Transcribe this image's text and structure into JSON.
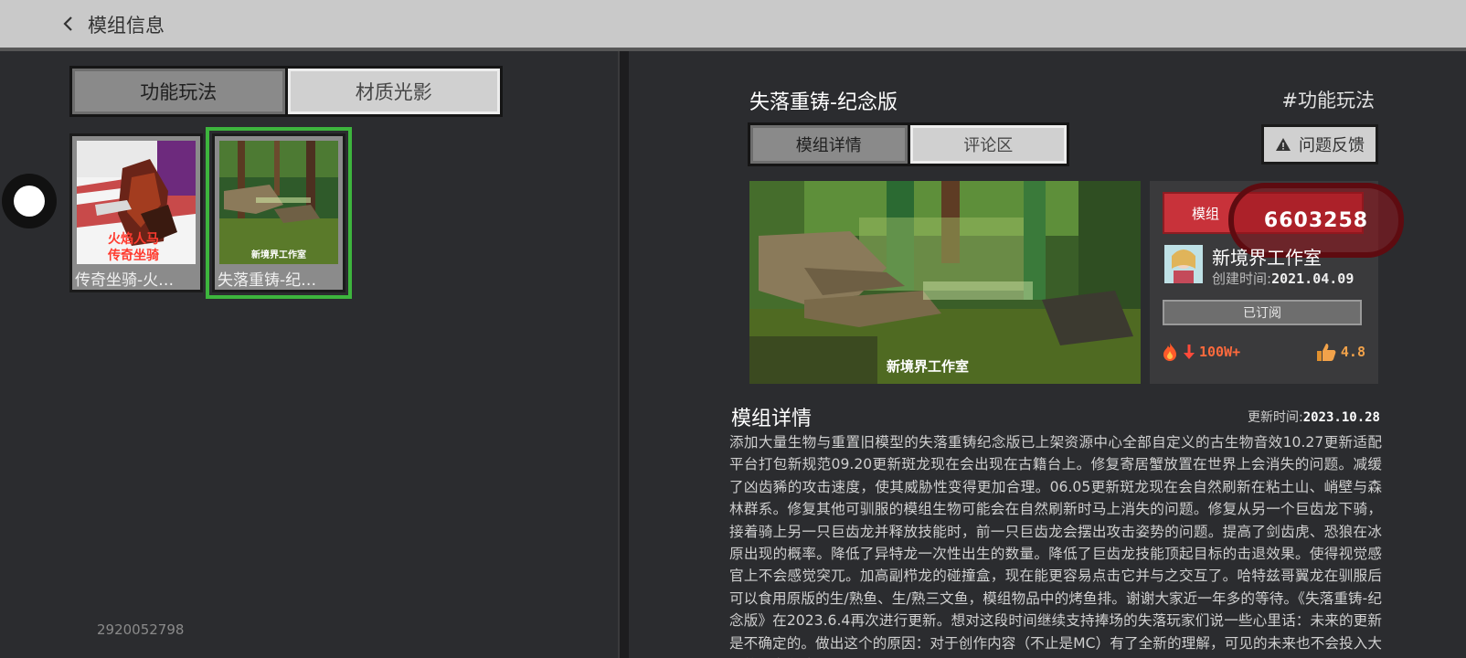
{
  "topbar": {
    "title": "模组信息"
  },
  "left": {
    "tabs": [
      {
        "label": "功能玩法",
        "active": true
      },
      {
        "label": "材质光影",
        "active": false
      }
    ],
    "cards": [
      {
        "name": "传奇坐骑-火…",
        "thumb_text": "火焰人马\n传奇坐骑",
        "selected": false
      },
      {
        "name": "失落重铸-纪…",
        "thumb_text": "新境界工作室",
        "selected": true
      }
    ],
    "user_id": "2920052798"
  },
  "detail": {
    "title": "失落重铸-纪念版",
    "category": "#功能玩法",
    "tabs": [
      {
        "label": "模组详情",
        "active": true
      },
      {
        "label": "评论区",
        "active": false
      }
    ],
    "feedback_label": "问题反馈",
    "preview_watermark": "新境界工作室",
    "subscribe_label": "模组",
    "subscribe_count": "6603258",
    "author_name": "新境界工作室",
    "created_label": "创建时间:",
    "created_date": "2021.04.09",
    "subscribed_label": "已订阅",
    "popularity": "100W+",
    "rating": "4.8",
    "section_title": "模组详情",
    "updated_label": "更新时间:",
    "updated_date": "2023.10.28",
    "description": "添加大量生物与重置旧模型的失落重铸纪念版已上架资源中心全部自定义的古生物音效10.27更新适配平台打包新规范09.20更新斑龙现在会出现在古籍台上。修复寄居蟹放置在世界上会消失的问题。减缓了凶齿豨的攻击速度，使其威胁性变得更加合理。06.05更新斑龙现在会自然刷新在粘土山、峭壁与森林群系。修复其他可驯服的模组生物可能会在自然刷新时马上消失的问题。修复从另一个巨齿龙下骑，接着骑上另一只巨齿龙并释放技能时，前一只巨齿龙会摆出攻击姿势的问题。提高了剑齿虎、恐狼在冰原出现的概率。降低了异特龙一次性出生的数量。降低了巨齿龙技能顶起目标的击退效果。使得视觉感官上不会感觉突兀。加高副栉龙的碰撞盒，现在能更容易点击它并与之交互了。哈特兹哥翼龙在驯服后可以食用原版的生/熟鱼、生/熟三文鱼，模组物品中的烤鱼排。谢谢大家近一年多的等待。《失落重铸-纪念版》在2023.6.4再次进行更新。想对这段时间继续支持捧场的失落玩家们说一些心里话：未来的更新是不确定的。做出这个的原因：对于创作内容（不止是MC）有了全新的理解，可见的未来也不会投入大量的心力在这里，以期"
  },
  "colors": {
    "accent_green": "#3db53d",
    "subscribe_red": "#c8323a",
    "popularity": "#ff6a3d",
    "rating": "#f2a24a"
  }
}
